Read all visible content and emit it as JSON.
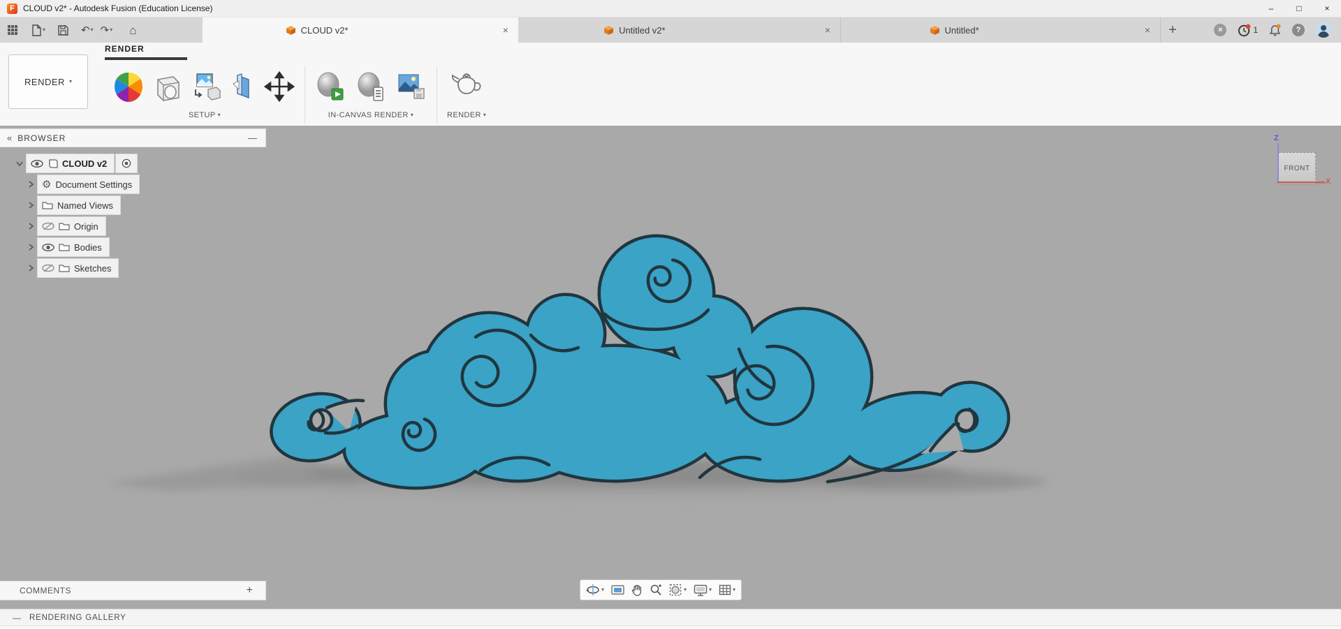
{
  "window": {
    "app_icon_letter": "F",
    "title": "CLOUD v2* - Autodesk Fusion (Education License)",
    "minimize": "–",
    "maximize": "□",
    "close": "×"
  },
  "quick_toolbar": {
    "undo_glyph": "↶",
    "redo_glyph": "↷",
    "home_glyph": "⌂",
    "caret": "▾"
  },
  "tabs": {
    "items": [
      {
        "label": "CLOUD v2*",
        "close": "×",
        "active": true
      },
      {
        "label": "Untitled v2*",
        "close": "×",
        "active": false
      },
      {
        "label": "Untitled*",
        "close": "×",
        "active": false
      }
    ],
    "new_tab": "+"
  },
  "top_right": {
    "job_count": "1",
    "help_glyph": "?",
    "extensions_glyph": "×"
  },
  "ribbon": {
    "workspace_button": "RENDER",
    "workspace_caret": "▾",
    "tab_label": "RENDER",
    "groups": [
      {
        "label": "SETUP",
        "caret": "▾"
      },
      {
        "label": "IN-CANVAS RENDER",
        "caret": "▾"
      },
      {
        "label": "RENDER",
        "caret": "▾"
      }
    ]
  },
  "browser": {
    "collapse_glyph": "«",
    "title": "BROWSER",
    "minimize_glyph": "—",
    "root": {
      "label": "CLOUD v2"
    },
    "rows": [
      {
        "label": "Document Settings",
        "icon": "gear",
        "eye": "none"
      },
      {
        "label": "Named Views",
        "icon": "folder",
        "eye": "none"
      },
      {
        "label": "Origin",
        "icon": "folder",
        "eye": "hidden"
      },
      {
        "label": "Bodies",
        "icon": "folder",
        "eye": "visible"
      },
      {
        "label": "Sketches",
        "icon": "folder",
        "eye": "hidden"
      }
    ],
    "gear_glyph": "⚙"
  },
  "viewcube": {
    "face": "FRONT",
    "z_axis": "Z",
    "x_axis": "X"
  },
  "comments": {
    "label": "COMMENTS",
    "add": "+"
  },
  "gallery": {
    "collapse": "—",
    "label": "RENDERING GALLERY"
  },
  "icons": {
    "quick": [
      "app-grid",
      "file",
      "save",
      "undo",
      "redo",
      "home"
    ],
    "ribbon_setup": [
      "appearance-wheel",
      "scene-settings",
      "texture-map-controls",
      "decal",
      "move"
    ],
    "ribbon_incanvas": [
      "in-canvas-render",
      "in-canvas-render-settings",
      "capture-image"
    ],
    "ribbon_render": [
      "render-teapot"
    ],
    "nav": [
      "orbit",
      "look-at",
      "pan",
      "zoom",
      "fit",
      "display-settings",
      "layout-grid"
    ]
  },
  "colors": {
    "cloud_fill": "#3AA3C6",
    "cloud_outline": "#21363F",
    "canvas_bg": "#A9A9A9",
    "tab_active_bg": "#F7F7F7",
    "accent_orange": "#E8762D",
    "badge_red": "#D6492F",
    "badge_orange": "#E8882D"
  }
}
